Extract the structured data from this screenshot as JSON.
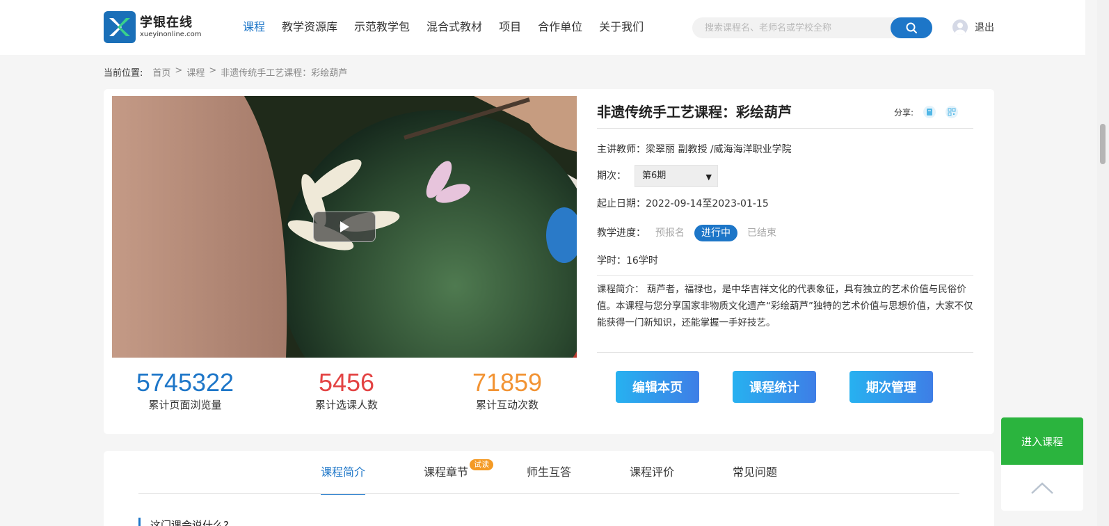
{
  "header": {
    "logo_cn": "学银在线",
    "logo_en": "xueyinonline.com",
    "nav": [
      "课程",
      "教学资源库",
      "示范教学包",
      "混合式教材",
      "项目",
      "合作单位",
      "关于我们"
    ],
    "search_placeholder": "搜索课程名、老师名或学校全称",
    "logout": "退出"
  },
  "breadcrumb": {
    "label": "当前位置:",
    "items": [
      "首页",
      "课程",
      "非遗传统手工艺课程：彩绘葫芦"
    ]
  },
  "course": {
    "title": "非遗传统手工艺课程：彩绘葫芦",
    "share_label": "分享:",
    "teacher": "主讲教师：梁翠丽 副教授 /威海海洋职业学院",
    "term_label": "期次：",
    "term_value": "第6期",
    "dates": "起止日期：2022-09-14至2023-01-15",
    "progress_label": "教学进度：",
    "progress_states": [
      "预报名",
      "进行中",
      "已结束"
    ],
    "hours": "学时：16学时",
    "intro": "课程简介：  葫芦者，福禄也，是中华吉祥文化的代表象征，具有独立的艺术价值与民俗价值。本课程与您分享国家非物质文化遗产“彩绘葫芦”独特的艺术价值与思想价值，大家不仅能获得一门新知识，还能掌握一手好技艺。"
  },
  "stats": [
    {
      "value": "5745322",
      "label": "累计页面浏览量",
      "color": "#1d76c8"
    },
    {
      "value": "5456",
      "label": "累计选课人数",
      "color": "#e34343"
    },
    {
      "value": "71859",
      "label": "累计互动次数",
      "color": "#f29333"
    }
  ],
  "actions": [
    "编辑本页",
    "课程统计",
    "期次管理"
  ],
  "tabs": {
    "items": [
      "课程简介",
      "课程章节",
      "师生互答",
      "课程评价",
      "常见问题"
    ],
    "badge": "试读",
    "section_title": "这门课会说什么?"
  },
  "floating": {
    "enter": "进入课程"
  },
  "colors": {
    "accent": "#1d76c8",
    "enter_green": "#2bb43e",
    "badge_orange": "#f49a25"
  }
}
